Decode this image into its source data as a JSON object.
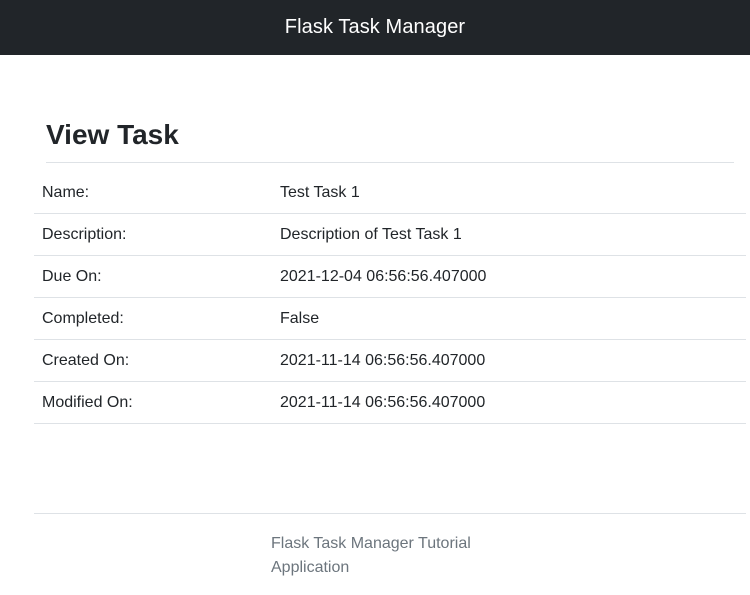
{
  "navbar": {
    "brand": "Flask Task Manager"
  },
  "page": {
    "title": "View Task"
  },
  "task": {
    "rows": [
      {
        "label": "Name:",
        "value": "Test Task 1"
      },
      {
        "label": "Description:",
        "value": "Description of Test Task 1"
      },
      {
        "label": "Due On:",
        "value": "2021-12-04 06:56:56.407000"
      },
      {
        "label": "Completed:",
        "value": "False"
      },
      {
        "label": "Created On:",
        "value": "2021-11-14 06:56:56.407000"
      },
      {
        "label": "Modified On:",
        "value": "2021-11-14 06:56:56.407000"
      }
    ]
  },
  "footer": {
    "text": "Flask Task Manager Tutorial Application"
  }
}
